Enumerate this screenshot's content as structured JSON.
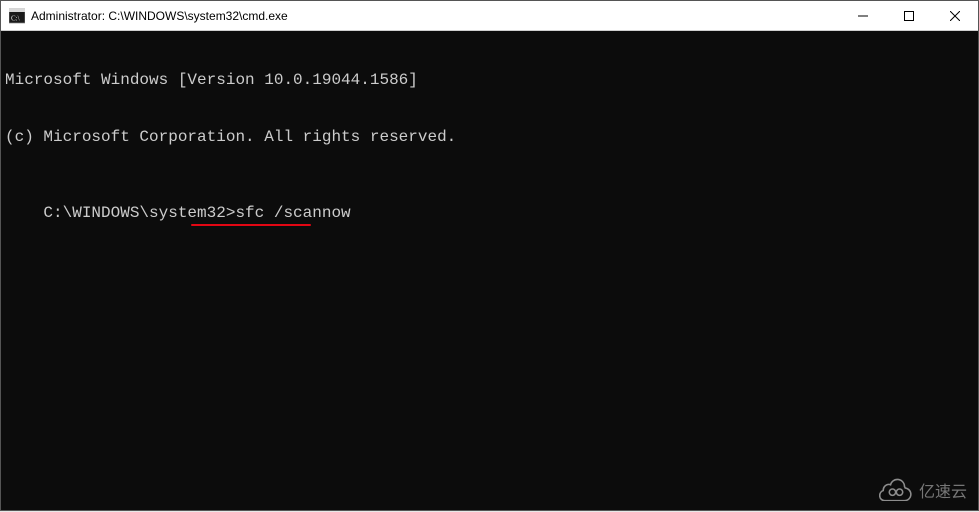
{
  "window": {
    "title": "Administrator: C:\\WINDOWS\\system32\\cmd.exe"
  },
  "terminal": {
    "lines": [
      "Microsoft Windows [Version 10.0.19044.1586]",
      "(c) Microsoft Corporation. All rights reserved.",
      "",
      ""
    ],
    "prompt": "C:\\WINDOWS\\system32>",
    "command": "sfc /scannow"
  },
  "watermark": {
    "text": "亿速云"
  }
}
